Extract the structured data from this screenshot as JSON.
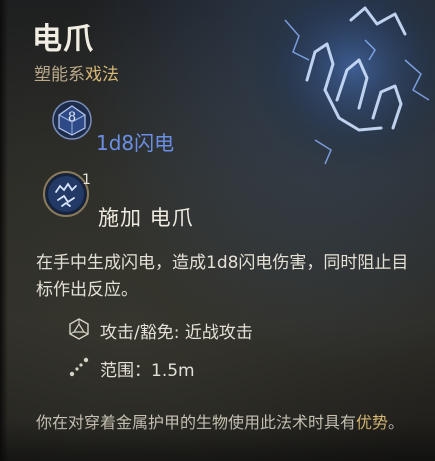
{
  "spell": {
    "name": "电爪",
    "school": "塑能系",
    "type": "戏法"
  },
  "damage": {
    "die_face": "8",
    "label": "1d8闪电"
  },
  "action": {
    "cost": "1",
    "label": "施加 电爪"
  },
  "description": "在手中生成闪电，造成1d8闪电伤害，同时阻止目标作出反应。",
  "stats": {
    "attack": "攻击/豁免: 近战攻击",
    "range": "范围：1.5m"
  },
  "footnote": {
    "text": "你在对穿着金属护甲的生物使用此法术时具有",
    "accent": "优势",
    "end": "。"
  },
  "icons": {
    "spell_art": "lightning-claw-art-icon",
    "die": "d8-die-icon",
    "action": "action-lightning-hand-icon",
    "attack": "d20-die-icon",
    "range": "range-dots-icon"
  },
  "colors": {
    "title": "#f2ede2",
    "school": "#b9a98a",
    "accent_gold": "#d7b874",
    "damage_blue": "#6c8fe6",
    "body_text": "#e4e0d6"
  }
}
